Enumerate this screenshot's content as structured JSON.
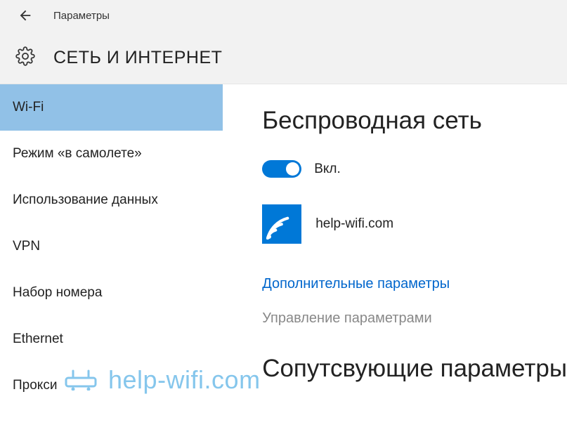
{
  "topbar": {
    "title": "Параметры"
  },
  "section": {
    "title": "СЕТЬ И ИНТЕРНЕТ"
  },
  "sidebar": {
    "items": [
      {
        "label": "Wi-Fi",
        "selected": true
      },
      {
        "label": "Режим «в самолете»"
      },
      {
        "label": "Использование данных"
      },
      {
        "label": "VPN"
      },
      {
        "label": "Набор номера"
      },
      {
        "label": "Ethernet"
      },
      {
        "label": "Прокси"
      }
    ]
  },
  "main": {
    "heading": "Беспроводная сеть",
    "toggle_label": "Вкл.",
    "network_name": "help-wifi.com",
    "link_more": "Дополнительные параметры",
    "manage_text": "Управление параметрами",
    "related_heading": "Сопутсвующие параметры"
  },
  "watermark": {
    "text": "help-wifi.com"
  }
}
